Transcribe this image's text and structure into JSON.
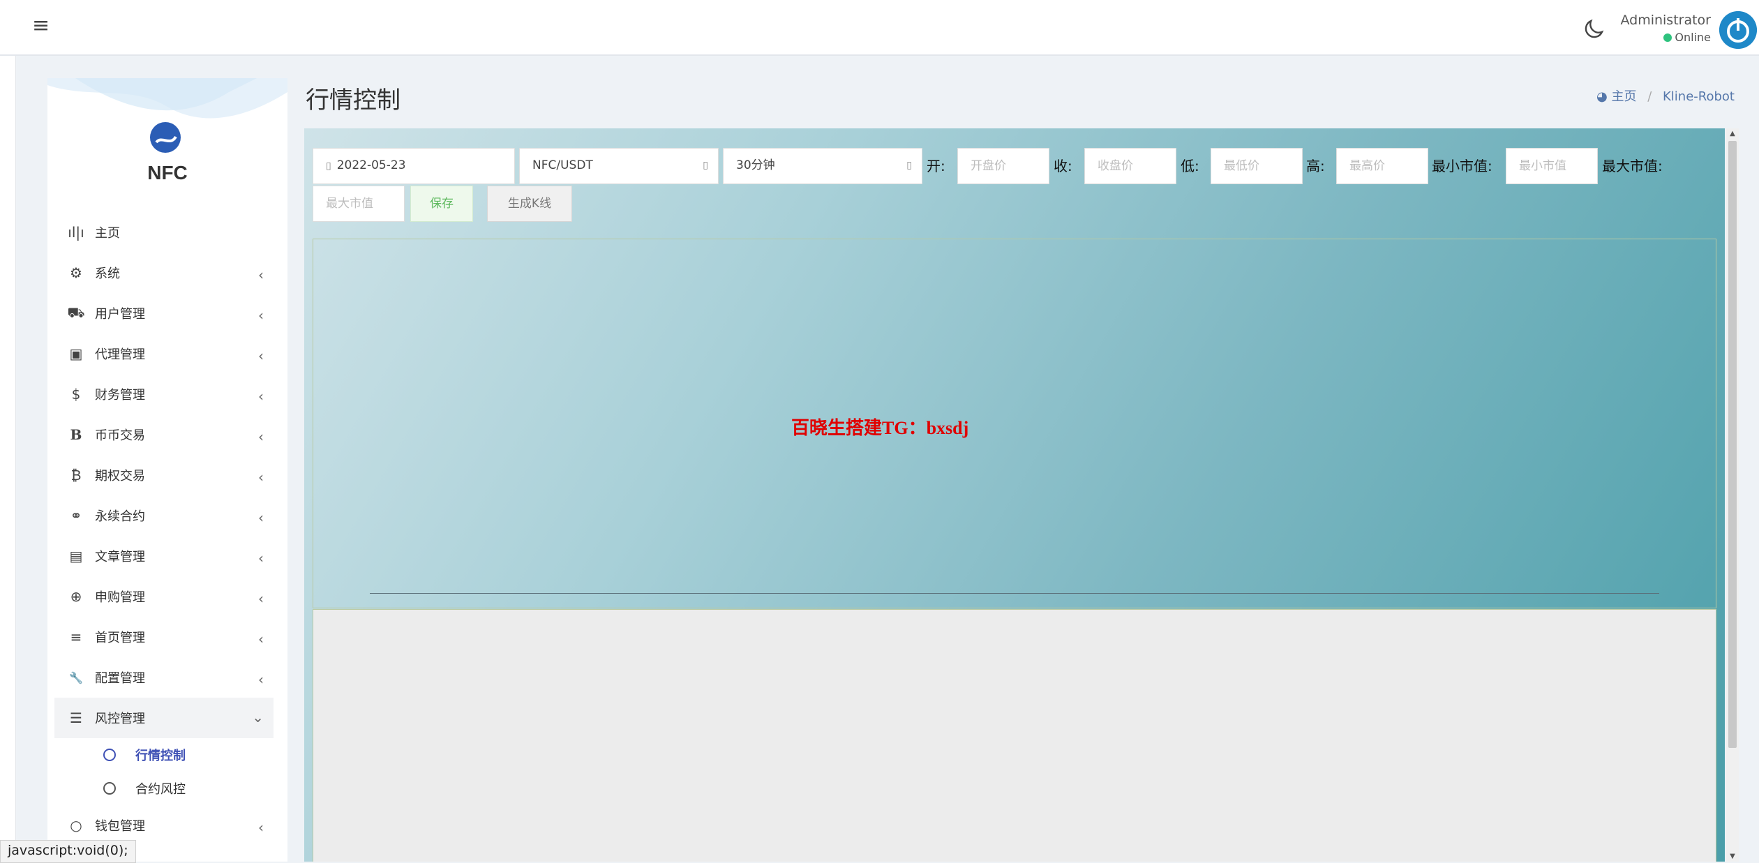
{
  "header": {
    "user_name": "Administrator",
    "user_status": "Online",
    "status_color": "#2ec27e"
  },
  "sidebar": {
    "logo_text": "NFC",
    "items": [
      {
        "label": "主页",
        "icon": "bar-chart-icon",
        "glyph": "ıl|ı"
      },
      {
        "label": "系统",
        "icon": "gear-icon",
        "glyph": "⚙"
      },
      {
        "label": "用户管理",
        "icon": "users-icon",
        "glyph": "⛟"
      },
      {
        "label": "代理管理",
        "icon": "id-card-icon",
        "glyph": "▣"
      },
      {
        "label": "财务管理",
        "icon": "dollar-icon",
        "glyph": "$"
      },
      {
        "label": "币币交易",
        "icon": "bitcoin-b-icon",
        "glyph": "B"
      },
      {
        "label": "期权交易",
        "icon": "bitcoin-icon",
        "glyph": "₿"
      },
      {
        "label": "永续合约",
        "icon": "link-icon",
        "glyph": "⚭"
      },
      {
        "label": "文章管理",
        "icon": "newspaper-icon",
        "glyph": "▤"
      },
      {
        "label": "申购管理",
        "icon": "lifebuoy-icon",
        "glyph": "⊕"
      },
      {
        "label": "首页管理",
        "icon": "list-icon",
        "glyph": "≡"
      },
      {
        "label": "配置管理",
        "icon": "wrench-icon",
        "glyph": "🔧"
      },
      {
        "label": "风控管理",
        "icon": "indent-icon",
        "glyph": "☰"
      }
    ],
    "sub_items": [
      {
        "label": "行情控制"
      },
      {
        "label": "合约风控"
      }
    ],
    "after_items": [
      {
        "label": "钱包管理",
        "icon": "circle-icon",
        "glyph": "○"
      }
    ]
  },
  "page": {
    "title": "行情控制",
    "breadcrumb_home": "主页",
    "breadcrumb_current": "Kline-Robot"
  },
  "controls": {
    "date": "2022-05-23",
    "pair": "NFC/USDT",
    "interval": "30分钟",
    "open_label": "开:",
    "open_placeholder": "开盘价",
    "close_label": "收:",
    "close_placeholder": "收盘价",
    "low_label": "低:",
    "low_placeholder": "最低价",
    "high_label": "高:",
    "high_placeholder": "最高价",
    "min_cap_label": "最小市值:",
    "min_cap_placeholder": "最小市值",
    "max_cap_label": "最大市值:",
    "max_cap_placeholder": "最大市值",
    "save_label": "保存",
    "generate_label": "生成K线"
  },
  "chart": {
    "watermark": "百晓生搭建TG：bxsdj"
  },
  "statusbar": {
    "text": "javascript:void(0);"
  }
}
